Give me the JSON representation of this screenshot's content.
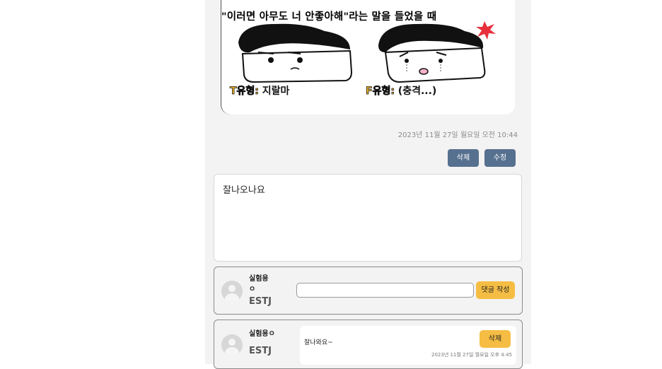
{
  "post": {
    "image_caption": "\"이러면 아무도 너 안좋아해\"라는 말을 들었을 때",
    "label_t_type": "T유형:",
    "label_t_text": " 지랄마",
    "label_f_type": "F유형:",
    "label_f_text": " (충격...)",
    "timestamp": "2023년 11월 27일 월요일 오전 10:44",
    "delete_label": "삭제",
    "edit_label": "수정",
    "body": "잘나오나요"
  },
  "comment_form": {
    "username": "실험용ㅇ",
    "mbti": "ESTJ",
    "input_value": "",
    "input_placeholder": "",
    "submit_label": "댓글 작성"
  },
  "comments": [
    {
      "username": "실험용ㅇ",
      "mbti": "ESTJ",
      "text": "잘나와요~",
      "date": "2023년 11월 27일 월요일 오후 4:45",
      "delete_label": "삭제"
    }
  ],
  "colors": {
    "dark_button": "#56708f",
    "yellow_button": "#f5bd43",
    "column_bg": "#f3f3f3"
  }
}
